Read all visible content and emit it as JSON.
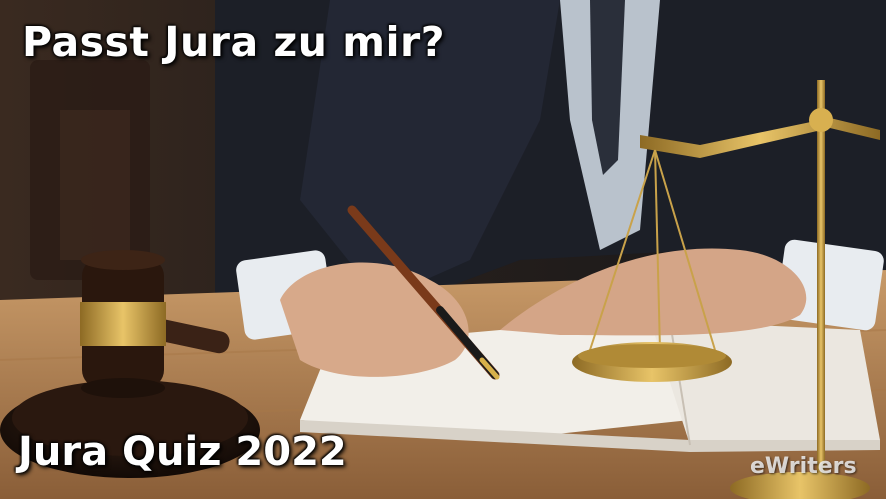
{
  "headline": "Passt Jura zu mir?",
  "subline": "Jura Quiz 2022",
  "logo": "eWriters",
  "colors": {
    "text": "#ffffff",
    "suit": "#1c1f27",
    "wood": "#b98a5a",
    "brass": "#c9a24a"
  }
}
